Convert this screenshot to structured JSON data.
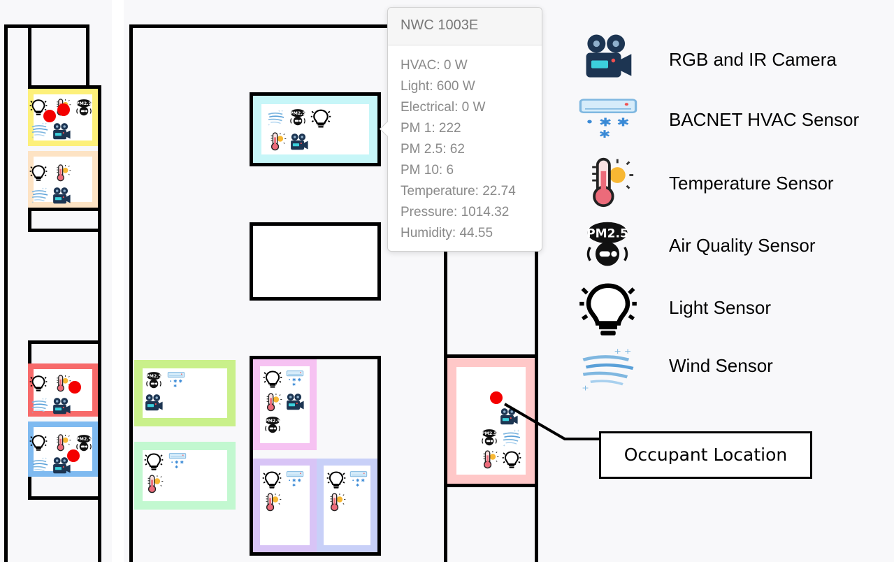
{
  "tooltip": {
    "title": "NWC 1003E",
    "lines": [
      "HVAC: 0 W",
      "Light: 600 W",
      "Electrical: 0 W",
      "PM 1: 222",
      "PM 2.5: 62",
      "PM 10: 6",
      "Temperature: 22.74",
      "Pressure: 1014.32",
      "Humidity: 44.55"
    ]
  },
  "legend": {
    "camera": "RGB and IR Camera",
    "hvac": "BACNET HVAC Sensor",
    "temperature": "Temperature Sensor",
    "air_quality": "Air Quality Sensor",
    "light": "Light Sensor",
    "wind": "Wind Sensor"
  },
  "callout": {
    "label": "Occupant Location"
  },
  "icon_badge_text": "PM2.5",
  "colors": {
    "occupant_dot": "#f40000",
    "room_yellow": "#fdf07a",
    "room_peach": "#fde3c4",
    "room_red": "#f76a6a",
    "room_blue": "#7fbaf0",
    "room_cyan": "#c7f6f8",
    "room_lime": "#c9f08a",
    "room_mint": "#c2f8d0",
    "room_pink": "#f6c2f2",
    "room_lavender": "#d8c4f6",
    "room_periwinkle": "#c8d0f8",
    "room_rose": "#ffc8c8"
  }
}
